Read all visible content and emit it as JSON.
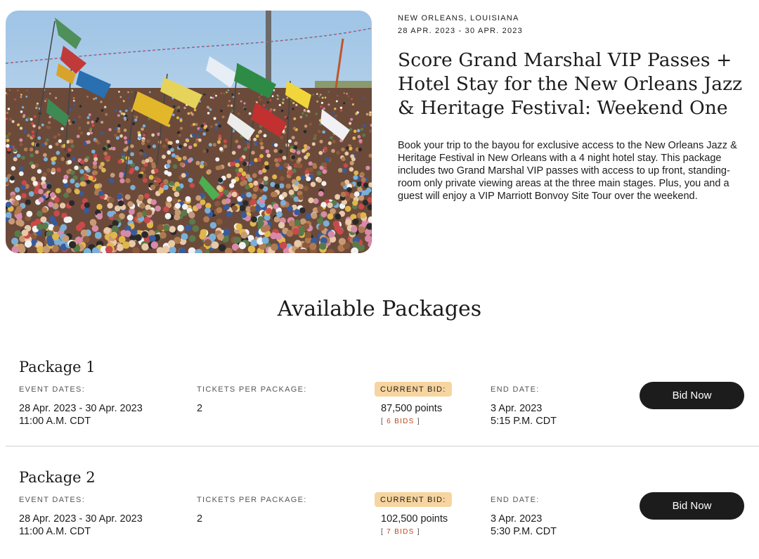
{
  "event": {
    "location": "NEW ORLEANS, LOUISIANA",
    "dates": "28 APR. 2023 - 30 APR. 2023",
    "title": "Score Grand Marshal VIP Passes + Hotel Stay for the New Orleans Jazz & Heritage Festival: Weekend One",
    "description": "Book your trip to the bayou for exclusive access to the New Orleans Jazz & Heritage Festival in New Orleans with a 4 night hotel stay. This package includes two Grand Marshal VIP passes with access to up front, standing-room only private viewing areas at the three main stages. Plus, you and a guest will enjoy a VIP Marriott Bonvoy Site Tour over the weekend."
  },
  "packages_heading": "Available Packages",
  "labels": {
    "event_dates": "EVENT DATES:",
    "tickets": "TICKETS PER PACKAGE:",
    "current_bid": "CURRENT BID:",
    "end_date": "END DATE:",
    "bid_button": "Bid Now",
    "bids_open": "[ ",
    "bids_close": " ]"
  },
  "packages": [
    {
      "name": "Package 1",
      "event_dates": "28 Apr. 2023 - 30 Apr. 2023",
      "event_time": "11:00 A.M. CDT",
      "tickets": "2",
      "current_bid": "87,500 points",
      "bids": "6 BIDS",
      "end_date": "3 Apr. 2023",
      "end_time": "5:15 P.M. CDT"
    },
    {
      "name": "Package 2",
      "event_dates": "28 Apr. 2023 - 30 Apr. 2023",
      "event_time": "11:00 A.M. CDT",
      "tickets": "2",
      "current_bid": "102,500 points",
      "bids": "7 BIDS",
      "end_date": "3 Apr. 2023",
      "end_time": "5:30 P.M. CDT"
    }
  ],
  "colors": {
    "bid_badge": "#f7d5a0",
    "bid_count": "#c0451a",
    "button": "#1c1c1c"
  }
}
